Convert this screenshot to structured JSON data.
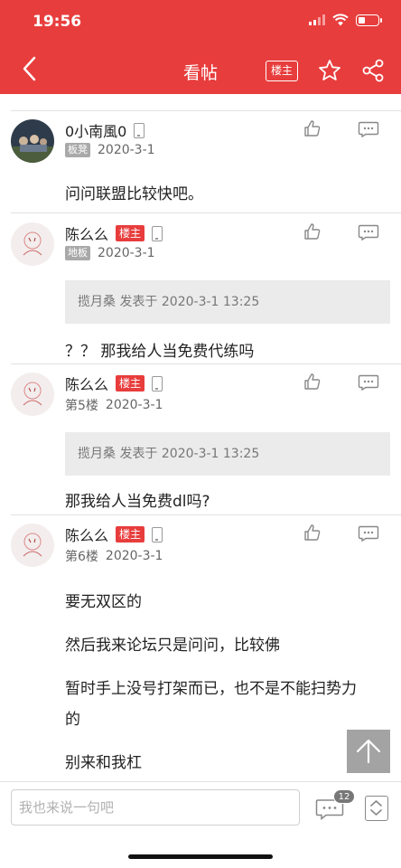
{
  "status_bar": {
    "time": "19:56"
  },
  "nav": {
    "title": "看帖",
    "op_filter_label": "楼主"
  },
  "posts": [
    {
      "author": "0小南風0",
      "floor": "板凳",
      "date": "2020-3-1",
      "body": [
        "问问联盟比较快吧。"
      ]
    },
    {
      "author": "陈么么",
      "op_tag": "楼主",
      "floor": "地板",
      "date": "2020-3-1",
      "quote": "揽月桑 发表于 2020-3-1 13:25",
      "body": [
        "？？ 那我给人当免费代练吗"
      ]
    },
    {
      "author": "陈么么",
      "op_tag": "楼主",
      "floor": "第5楼",
      "date": "2020-3-1",
      "quote": "揽月桑 发表于 2020-3-1 13:25",
      "body": [
        "那我给人当免费dl吗?"
      ]
    },
    {
      "author": "陈么么",
      "op_tag": "楼主",
      "floor": "第6楼",
      "date": "2020-3-1",
      "body": [
        "要无双区的",
        "然后我来论坛只是问问，比较佛",
        "暂时手上没号打架而已，也不是不能扫势力",
        "的",
        "别来和我杠"
      ]
    }
  ],
  "bottom_bar": {
    "input_placeholder": "我也来说一句吧",
    "comment_count": "12"
  },
  "colors": {
    "brand_red": "#e83d3d",
    "op_tag_red": "#e83d3d",
    "floor_tag_gray": "#a9a9a9",
    "quote_bg": "#ebebeb"
  },
  "icons": [
    "back-icon",
    "star-icon",
    "share-icon",
    "thumbs-up-icon",
    "reply-icon",
    "phone-icon",
    "arrow-up-icon",
    "comments-icon",
    "jump-icon"
  ]
}
